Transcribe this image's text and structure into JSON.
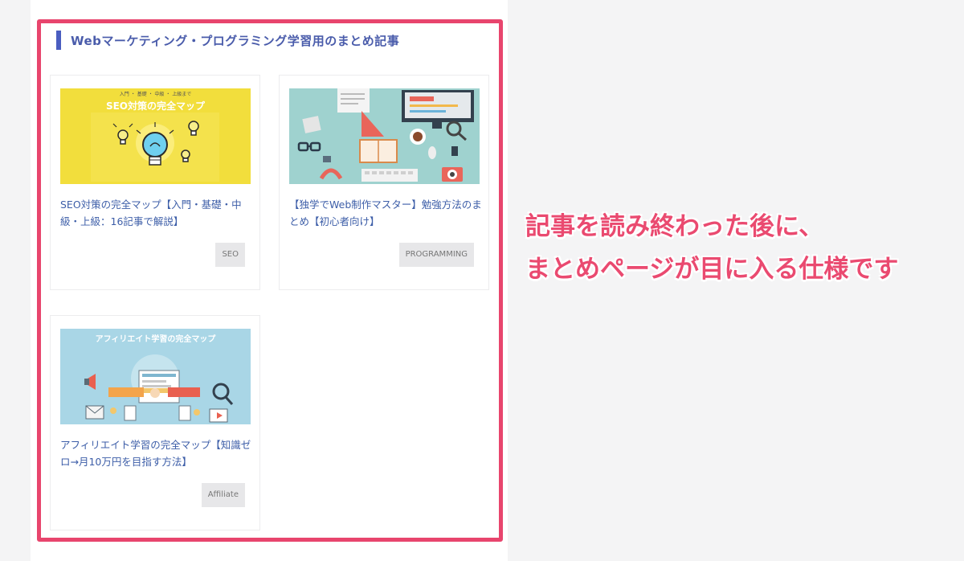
{
  "section": {
    "title": "Webマーケティング・プログラミング学習用のまとめ記事"
  },
  "cards": [
    {
      "title": "SEO対策の完全マップ【入門・基礎・中級・上級：16記事で解説】",
      "tag": "SEO",
      "thumb_top": "入門 ・ 基礎 ・ 中級 ・ 上級まで",
      "thumb_title": "SEO対策の完全マップ"
    },
    {
      "title": "【独学でWeb制作マスター】勉強方法のまとめ【初心者向け】",
      "tag": "PROGRAMMING"
    },
    {
      "title": "アフィリエイト学習の完全マップ【知識ゼロ→月10万円を目指す方法】",
      "tag": "Affiliate",
      "thumb_title": "アフィリエイト学習の完全マップ"
    }
  ],
  "annotation": {
    "line1": "記事を読み終わった後に、",
    "line2": "まとめページが目に入る仕様です"
  },
  "colors": {
    "frame": "#e8456d",
    "heading": "#4a5cab",
    "link": "#3d5ea8",
    "thumb_yellow": "#f2de3c",
    "thumb_teal": "#9fd2cf",
    "thumb_blue": "#a9d6e6"
  }
}
